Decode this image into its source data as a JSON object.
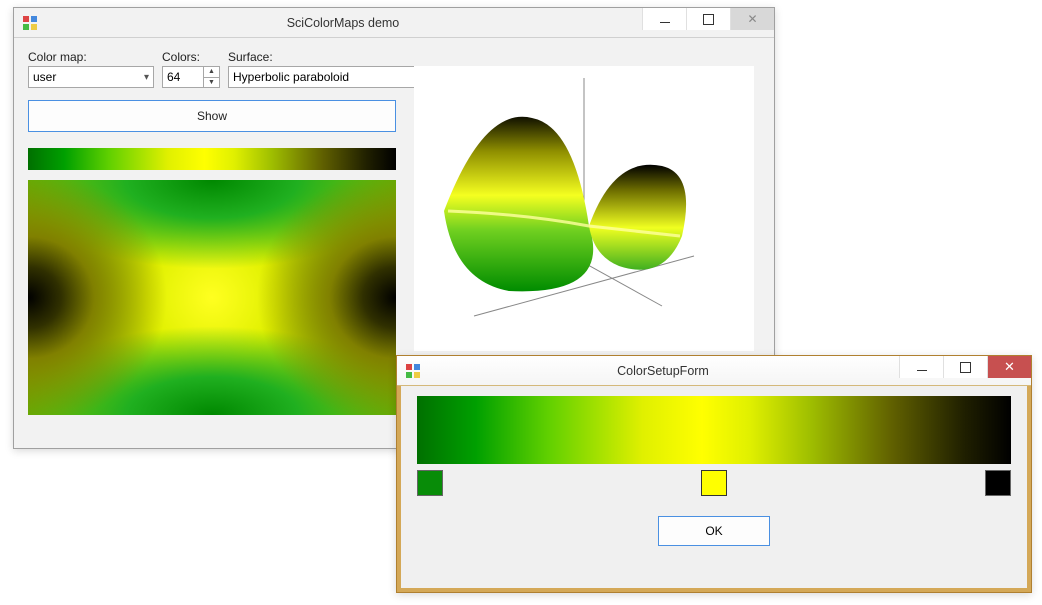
{
  "main_window": {
    "title": "SciColorMaps demo",
    "labels": {
      "colormap": "Color map:",
      "colors": "Colors:",
      "surface": "Surface:"
    },
    "values": {
      "colormap": "user",
      "colors": "64",
      "surface": "Hyperbolic paraboloid"
    },
    "buttons": {
      "show": "Show"
    },
    "gradient_colors": [
      "#007000",
      "#ffff00",
      "#000000"
    ]
  },
  "setup_window": {
    "title": "ColorSetupForm",
    "buttons": {
      "ok": "OK"
    },
    "swatches": {
      "left": "#088c08",
      "mid": "#ffff00",
      "right": "#000000"
    }
  },
  "icons": {
    "chevron_down": "▾",
    "spin_up": "▲",
    "spin_down": "▼"
  }
}
